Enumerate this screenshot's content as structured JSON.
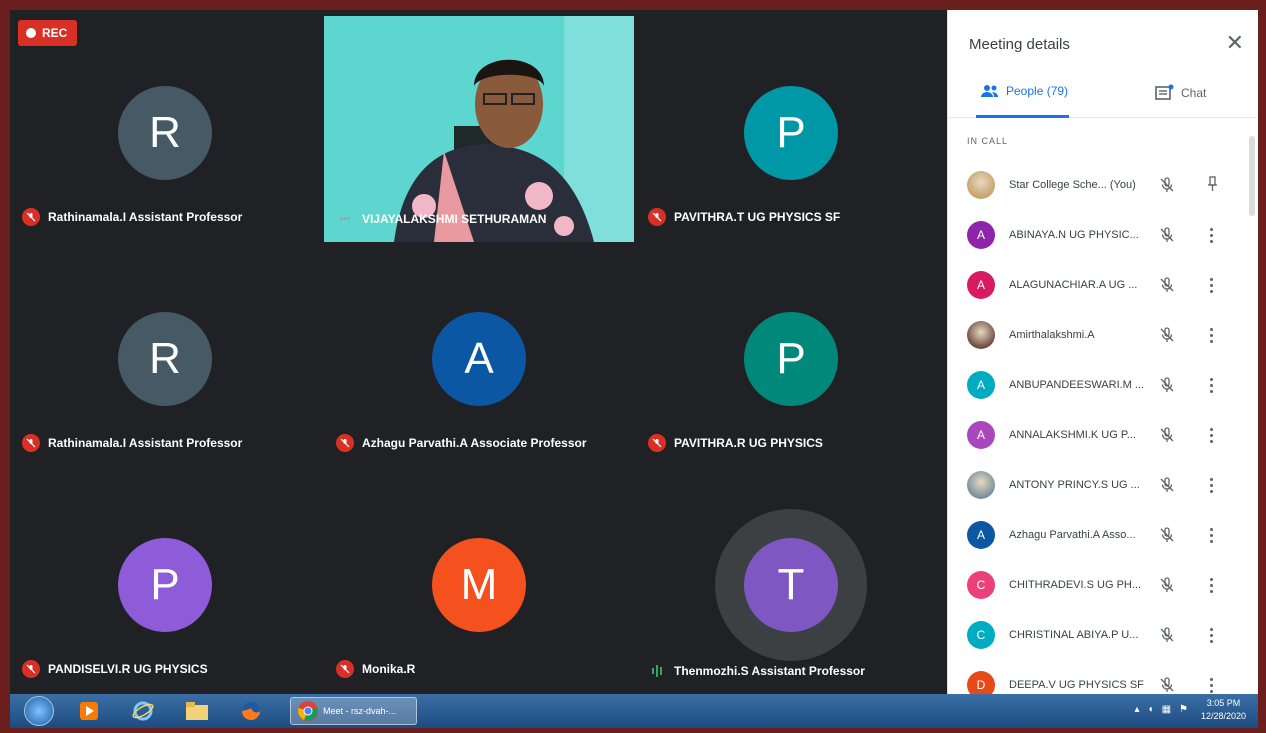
{
  "meeting": {
    "rec_label": "REC",
    "tiles": [
      {
        "initial": "R",
        "name": "Rathinamala.I Assistant Professor",
        "color": "#455a64",
        "mic": "off"
      },
      {
        "initial": "",
        "name": "VIJAYALAKSHMI SETHURAMAN",
        "color": "",
        "mic": "dots"
      },
      {
        "initial": "P",
        "name": "PAVITHRA.T UG PHYSICS SF",
        "color": "#0097a7",
        "mic": "off"
      },
      {
        "initial": "R",
        "name": "Rathinamala.I Assistant Professor",
        "color": "#455a64",
        "mic": "off"
      },
      {
        "initial": "A",
        "name": "Azhagu Parvathi.A Associate Professor",
        "color": "#0b57a4",
        "mic": "off"
      },
      {
        "initial": "P",
        "name": "PAVITHRA.R UG PHYSICS",
        "color": "#00897b",
        "mic": "off"
      },
      {
        "initial": "P",
        "name": "PANDISELVI.R UG PHYSICS",
        "color": "#8e5cd9",
        "mic": "off"
      },
      {
        "initial": "M",
        "name": "Monika.R",
        "color": "#f4511e",
        "mic": "off"
      },
      {
        "initial": "T",
        "name": "Thenmozhi.S Assistant Professor",
        "color": "#7e57c2",
        "mic": "speaking"
      }
    ]
  },
  "panel": {
    "title": "Meeting details",
    "close_icon": "close-icon",
    "tab_people": "People (79)",
    "tab_chat": "Chat",
    "section_label": "IN CALL",
    "participants": [
      {
        "initial": "",
        "name": "Star College Sche... (You)",
        "color": "#c8a26a",
        "photo": true
      },
      {
        "initial": "A",
        "name": "ABINAYA.N UG PHYSIC...",
        "color": "#8e24aa"
      },
      {
        "initial": "A",
        "name": "ALAGUNACHIAR.A UG ...",
        "color": "#d81b60"
      },
      {
        "initial": "",
        "name": "Amirthalakshmi.A",
        "color": "#6d4c41",
        "photo": true
      },
      {
        "initial": "A",
        "name": "ANBUPANDEESWARI.M ...",
        "color": "#00acc1"
      },
      {
        "initial": "A",
        "name": "ANNALAKSHMI.K UG P...",
        "color": "#ab47bc"
      },
      {
        "initial": "",
        "name": "ANTONY PRINCY.S UG ...",
        "color": "#78909c",
        "photo": true
      },
      {
        "initial": "A",
        "name": "Azhagu Parvathi.A Asso...",
        "color": "#0b57a4"
      },
      {
        "initial": "C",
        "name": "CHITHRADEVI.S UG PH...",
        "color": "#ec407a"
      },
      {
        "initial": "C",
        "name": "CHRISTINAL ABIYA.P U...",
        "color": "#00acc1"
      },
      {
        "initial": "D",
        "name": "DEEPA.V UG PHYSICS SF",
        "color": "#e64a19"
      }
    ]
  },
  "taskbar": {
    "task_label": "Meet - rsz-dvah-...",
    "time": "3:05 PM",
    "date": "12/28/2020"
  }
}
